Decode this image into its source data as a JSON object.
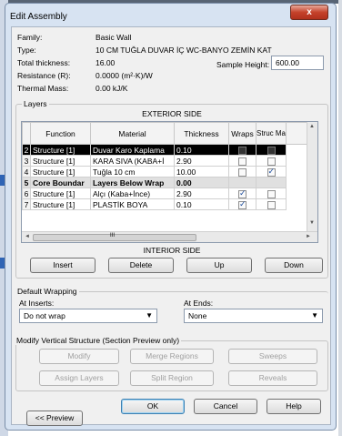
{
  "window": {
    "title": "Edit Assembly",
    "close_glyph": "x"
  },
  "properties": [
    {
      "label": "Family:",
      "value": "Basic Wall"
    },
    {
      "label": "Type:",
      "value": "10 CM TUĞLA DUVAR İÇ WC-BANYO ZEMİN KAT"
    },
    {
      "label": "Total thickness:",
      "value": "16.00"
    },
    {
      "label": "Resistance (R):",
      "value": "0.0000 (m²·K)/W"
    },
    {
      "label": "Thermal Mass:",
      "value": "0.00 kJ/K"
    }
  ],
  "sample_height": {
    "label": "Sample Height:",
    "value": "600.00"
  },
  "layers": {
    "group_title": "Layers",
    "exterior_label": "EXTERIOR SIDE",
    "interior_label": "INTERIOR SIDE",
    "columns": [
      "",
      "Function",
      "Material",
      "Thickness",
      "Wraps",
      "Struc Ma"
    ],
    "rows": [
      {
        "num": "2",
        "function": "Structure [1]",
        "material": "Duvar Karo Kaplama",
        "thickness": "0.10",
        "wraps": false,
        "structural": false,
        "style": "selected"
      },
      {
        "num": "3",
        "function": "Structure [1]",
        "material": "KARA SIVA (KABA+İ",
        "thickness": "2.90",
        "wraps": false,
        "structural": false,
        "style": ""
      },
      {
        "num": "4",
        "function": "Structure [1]",
        "material": "Tuğla 10 cm",
        "thickness": "10.00",
        "wraps": false,
        "structural": true,
        "style": ""
      },
      {
        "num": "5",
        "function": "Core Boundar",
        "material": "Layers Below Wrap",
        "thickness": "0.00",
        "wraps": null,
        "structural": null,
        "style": "bold"
      },
      {
        "num": "6",
        "function": "Structure [1]",
        "material": "Alçı (Kaba+İnce)",
        "thickness": "2.90",
        "wraps": true,
        "structural": false,
        "style": ""
      },
      {
        "num": "7",
        "function": "Structure [1]",
        "material": "PLASTİK BOYA",
        "thickness": "0.10",
        "wraps": true,
        "structural": false,
        "style": ""
      }
    ],
    "scroll_thumb_glyph": "III",
    "buttons": {
      "insert": "Insert",
      "delete": "Delete",
      "up": "Up",
      "down": "Down"
    }
  },
  "default_wrapping": {
    "group_title": "Default Wrapping",
    "at_inserts_label": "At Inserts:",
    "at_inserts_value": "Do not wrap",
    "at_ends_label": "At Ends:",
    "at_ends_value": "None"
  },
  "modify_vertical": {
    "group_title": "Modify Vertical Structure (Section Preview only)",
    "buttons": {
      "modify": "Modify",
      "merge": "Merge Regions",
      "sweeps": "Sweeps",
      "assign": "Assign Layers",
      "split": "Split Region",
      "reveals": "Reveals"
    }
  },
  "footer": {
    "ok": "OK",
    "cancel": "Cancel",
    "help": "Help",
    "preview": "<< Preview"
  }
}
